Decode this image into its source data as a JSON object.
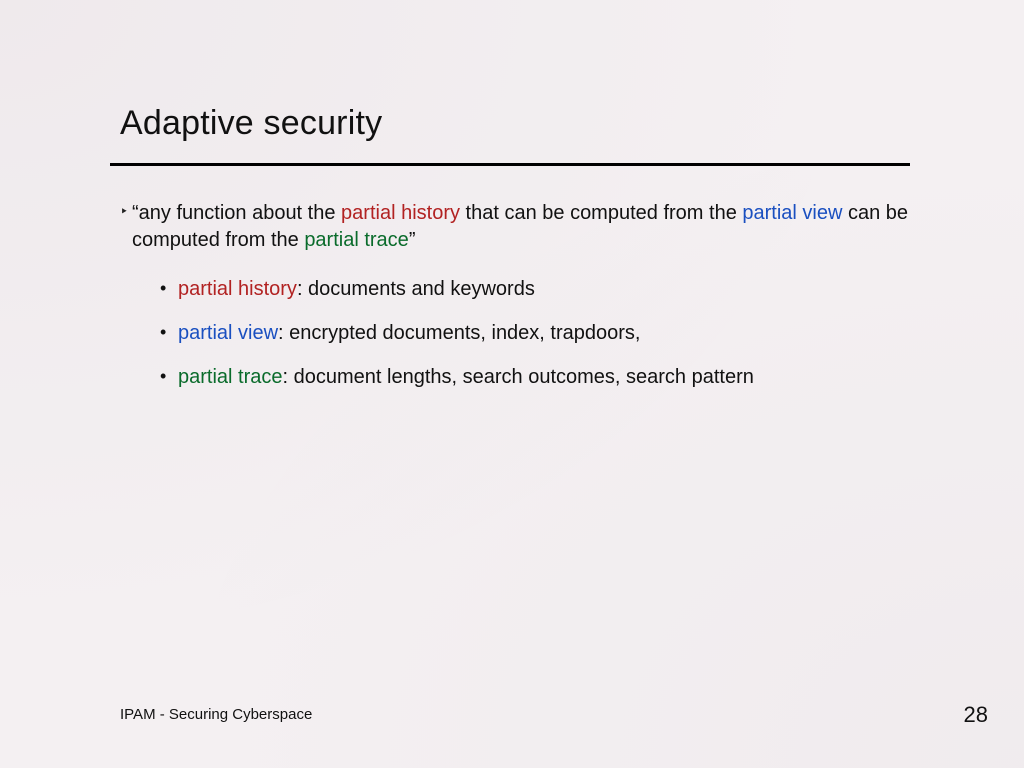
{
  "title": "Adaptive security",
  "lead": {
    "pre": "“any function about the ",
    "term1": "partial history",
    "mid1": " that can be computed from the ",
    "term2": "partial view",
    "mid2": " can be computed from the ",
    "term3": "partial trace",
    "post": "”"
  },
  "items": [
    {
      "term": "partial history",
      "rest": ": documents and keywords",
      "termClass": "term-red"
    },
    {
      "term": "partial view",
      "rest": ": encrypted documents, index, trapdoors,",
      "termClass": "term-blue"
    },
    {
      "term": "partial trace",
      "rest": ": document lengths, search outcomes, search pattern",
      "termClass": "term-green"
    }
  ],
  "footer": {
    "left": "IPAM - Securing Cyberspace",
    "page": "28"
  }
}
